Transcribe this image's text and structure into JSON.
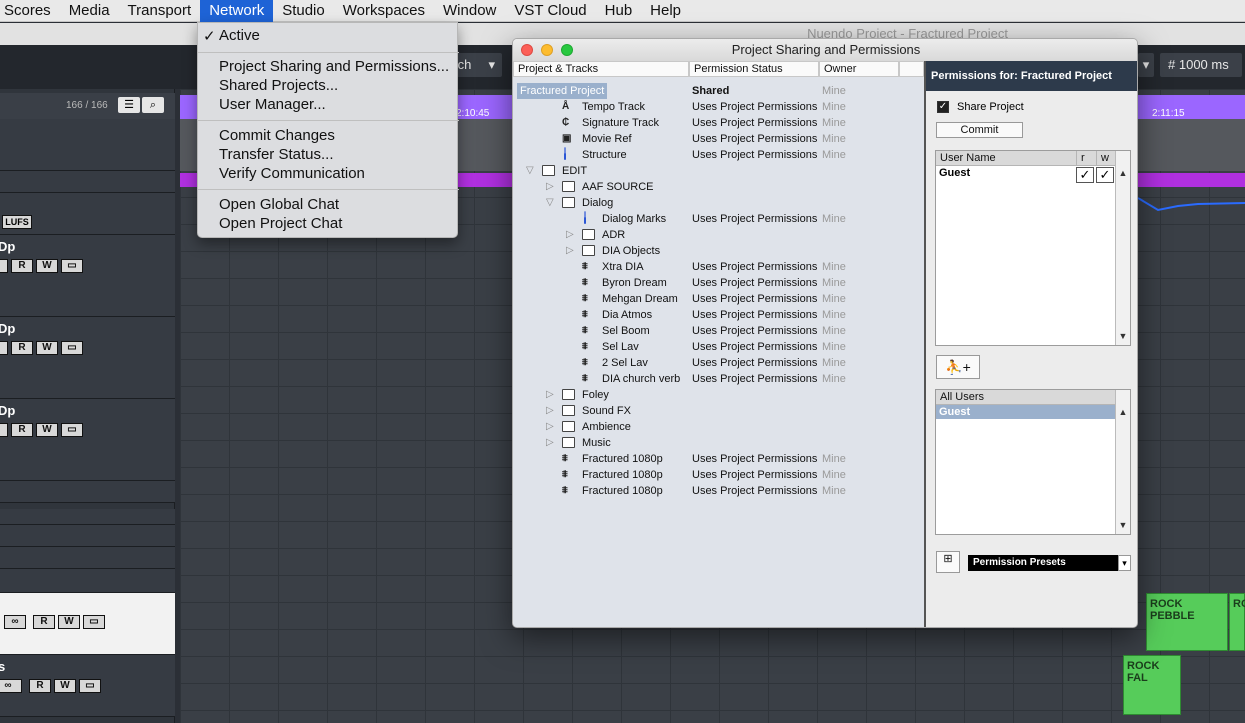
{
  "menubar": {
    "items": [
      "Scores",
      "Media",
      "Transport",
      "Network",
      "Studio",
      "Workspaces",
      "Window",
      "VST Cloud",
      "Hub",
      "Help"
    ],
    "active": "Network"
  },
  "window_title": "Nuendo Project - Fractured Project",
  "toolbar": {
    "sync_label": "tch",
    "time_label": "1000 ms"
  },
  "tracklist": {
    "counter": "166 / 166",
    "lufs": "LUFS",
    "track_names": [
      "Dp",
      "Dp",
      "Dp",
      "s"
    ],
    "btn_r": "R",
    "btn_w": "W"
  },
  "ruler": {
    "t1": "2:10:45",
    "t2": "2:11:15"
  },
  "clips": {
    "c1": "ROCK PEBBLE",
    "c2": "RO",
    "c3": "ROCK FAL"
  },
  "dropdown": {
    "active": "Active",
    "items": [
      "Project Sharing and Permissions...",
      "Shared Projects...",
      "User Manager...",
      "Commit Changes",
      "Transfer Status...",
      "Verify Communication",
      "Open Global Chat",
      "Open Project Chat"
    ]
  },
  "dialog": {
    "title": "Project Sharing and Permissions",
    "columns": [
      "Project & Tracks",
      "Permission Status",
      "Owner"
    ],
    "rows": [
      {
        "name": "Fractured Project",
        "status": "Shared",
        "owner": "Mine"
      },
      {
        "name": "Tempo Track",
        "status": "Uses Project Permissions",
        "owner": "Mine"
      },
      {
        "name": "Signature Track",
        "status": "Uses Project Permissions",
        "owner": "Mine"
      },
      {
        "name": "Movie Ref",
        "status": "Uses Project Permissions",
        "owner": "Mine"
      },
      {
        "name": "Structure",
        "status": "Uses Project Permissions",
        "owner": "Mine"
      },
      {
        "name": "EDIT",
        "status": "",
        "owner": ""
      },
      {
        "name": "AAF SOURCE",
        "status": "",
        "owner": ""
      },
      {
        "name": "Dialog",
        "status": "",
        "owner": ""
      },
      {
        "name": "Dialog Marks",
        "status": "Uses Project Permissions",
        "owner": "Mine"
      },
      {
        "name": "ADR",
        "status": "",
        "owner": ""
      },
      {
        "name": "DIA Objects",
        "status": "",
        "owner": ""
      },
      {
        "name": "Xtra DIA",
        "status": "Uses Project Permissions",
        "owner": "Mine"
      },
      {
        "name": "Byron Dream",
        "status": "Uses Project Permissions",
        "owner": "Mine"
      },
      {
        "name": "Mehgan Dream",
        "status": "Uses Project Permissions",
        "owner": "Mine"
      },
      {
        "name": "Dia Atmos",
        "status": "Uses Project Permissions",
        "owner": "Mine"
      },
      {
        "name": "Sel Boom",
        "status": "Uses Project Permissions",
        "owner": "Mine"
      },
      {
        "name": "Sel Lav",
        "status": "Uses Project Permissions",
        "owner": "Mine"
      },
      {
        "name": "2 Sel Lav",
        "status": "Uses Project Permissions",
        "owner": "Mine"
      },
      {
        "name": "DIA church verb",
        "status": "Uses Project Permissions",
        "owner": "Mine"
      },
      {
        "name": "Foley",
        "status": "",
        "owner": ""
      },
      {
        "name": "Sound FX",
        "status": "",
        "owner": ""
      },
      {
        "name": "Ambience",
        "status": "",
        "owner": ""
      },
      {
        "name": "Music",
        "status": "",
        "owner": ""
      },
      {
        "name": "Fractured 1080p",
        "status": "Uses Project Permissions",
        "owner": "Mine"
      },
      {
        "name": "Fractured 1080p",
        "status": "Uses Project Permissions",
        "owner": "Mine"
      },
      {
        "name": "Fractured 1080p",
        "status": "Uses Project Permissions",
        "owner": "Mine"
      }
    ],
    "permissions": {
      "header": "Permissions for: Fractured Project",
      "share_label": "Share Project",
      "share_checked": true,
      "commit_label": "Commit",
      "users_header": "User Name",
      "col_r": "r",
      "col_w": "w",
      "users": [
        {
          "name": "Guest",
          "r": true,
          "w": true
        }
      ],
      "all_users_header": "All Users",
      "all_users": [
        "Guest"
      ],
      "presets_label": "Permission Presets"
    }
  }
}
